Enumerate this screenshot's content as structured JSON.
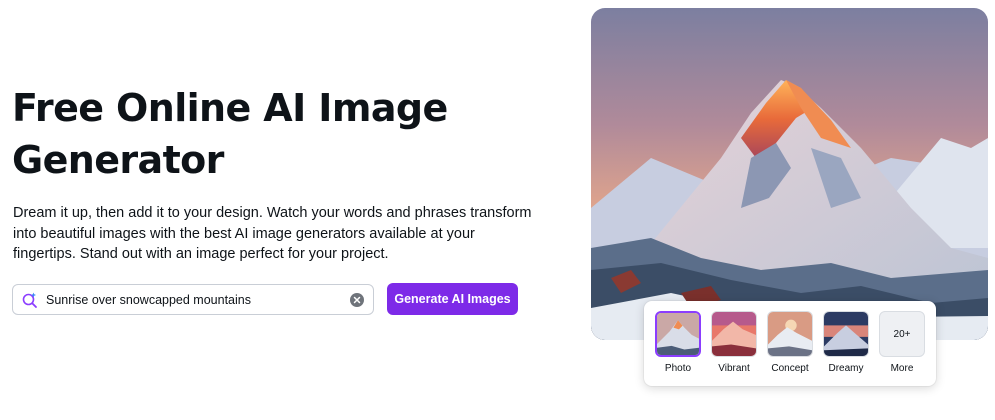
{
  "hero": {
    "title": "Free Online AI Image Generator",
    "description": "Dream it up, then add it to your design. Watch your words and phrases transform into beautiful images with the best AI image generators available at your fingertips. Stand out with an image perfect for your project."
  },
  "prompt": {
    "value": "Sunrise over snowcapped mountains",
    "icon": "sparkle-search-icon",
    "clear_icon": "clear-icon"
  },
  "generate_button": {
    "label": "Generate AI Images",
    "color": "#7d2ae8"
  },
  "styles": {
    "selected": "Photo",
    "options": [
      {
        "label": "Photo"
      },
      {
        "label": "Vibrant"
      },
      {
        "label": "Concept"
      },
      {
        "label": "Dreamy"
      }
    ],
    "more": {
      "badge": "20+",
      "label": "More"
    }
  }
}
